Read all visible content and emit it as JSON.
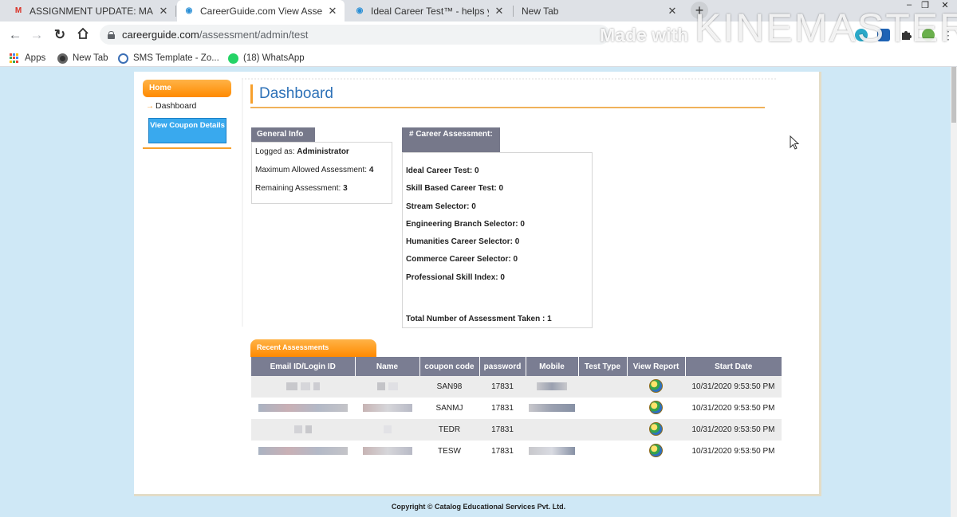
{
  "tabs": [
    {
      "title": "ASSIGNMENT UPDATE: MACHAI",
      "favicon": "gmail-icon",
      "active": false
    },
    {
      "title": "CareerGuide.com View Assessme",
      "favicon": "careerguide-icon",
      "active": true
    },
    {
      "title": "Ideal Career Test™ - helps you id",
      "favicon": "careerguide-icon",
      "active": false
    },
    {
      "title": "New Tab",
      "favicon": "",
      "active": false
    }
  ],
  "address_bar": {
    "domain": "careerguide.com",
    "path": "/assessment/admin/test"
  },
  "bookmarks": [
    {
      "label": "Apps",
      "icon": "apps-grid-icon"
    },
    {
      "label": "New Tab",
      "icon": "chrome-icon"
    },
    {
      "label": "SMS Template - Zo...",
      "icon": "zoho-icon"
    },
    {
      "label": "(18) WhatsApp",
      "icon": "whatsapp-icon"
    }
  ],
  "watermark": {
    "small": "Made with",
    "big": "KINEMASTER"
  },
  "sidebar": {
    "home": "Home",
    "dashboard_link": "Dashboard",
    "coupon_button": "View Coupon Details"
  },
  "dashboard": {
    "title": "Dashboard"
  },
  "general_info": {
    "heading": "General Info",
    "rows": [
      {
        "label": "Logged as: ",
        "value": "Administrator"
      },
      {
        "label": "Maximum Allowed Assessment: ",
        "value": "4"
      },
      {
        "label": "Remaining Assessment: ",
        "value": "3"
      }
    ]
  },
  "career_assessment": {
    "heading": "# Career Assessment:",
    "rows": [
      "Ideal Career Test: 0",
      "Skill Based Career Test: 0",
      "Stream Selector: 0",
      "Engineering Branch Selector: 0",
      "Humanities Career Selector: 0",
      "Commerce Career Selector: 0",
      "Professional Skill Index: 0"
    ],
    "total": "Total Number of Assessment Taken : 1"
  },
  "recent": {
    "tab_label": "Recent Assessments",
    "columns": [
      "Email ID/Login ID",
      "Name",
      "coupon code",
      "password",
      "Mobile",
      "Test Type",
      "View Report",
      "Start Date"
    ],
    "rows": [
      {
        "coupon": "SAN98",
        "password": "17831",
        "start_date": "10/31/2020 9:53:50 PM"
      },
      {
        "coupon": "SANMJ",
        "password": "17831",
        "start_date": "10/31/2020 9:53:50 PM"
      },
      {
        "coupon": "TEDR",
        "password": "17831",
        "start_date": "10/31/2020 9:53:50 PM"
      },
      {
        "coupon": "TESW",
        "password": "17831",
        "start_date": "10/31/2020 9:53:50 PM"
      }
    ]
  },
  "footer": "Copyright © Catalog Educational Services Pvt. Ltd.",
  "colors": {
    "accent_orange": "#ff8a00",
    "header_grey": "#76788a",
    "button_blue": "#39a9ee",
    "title_blue": "#2e72b8"
  }
}
